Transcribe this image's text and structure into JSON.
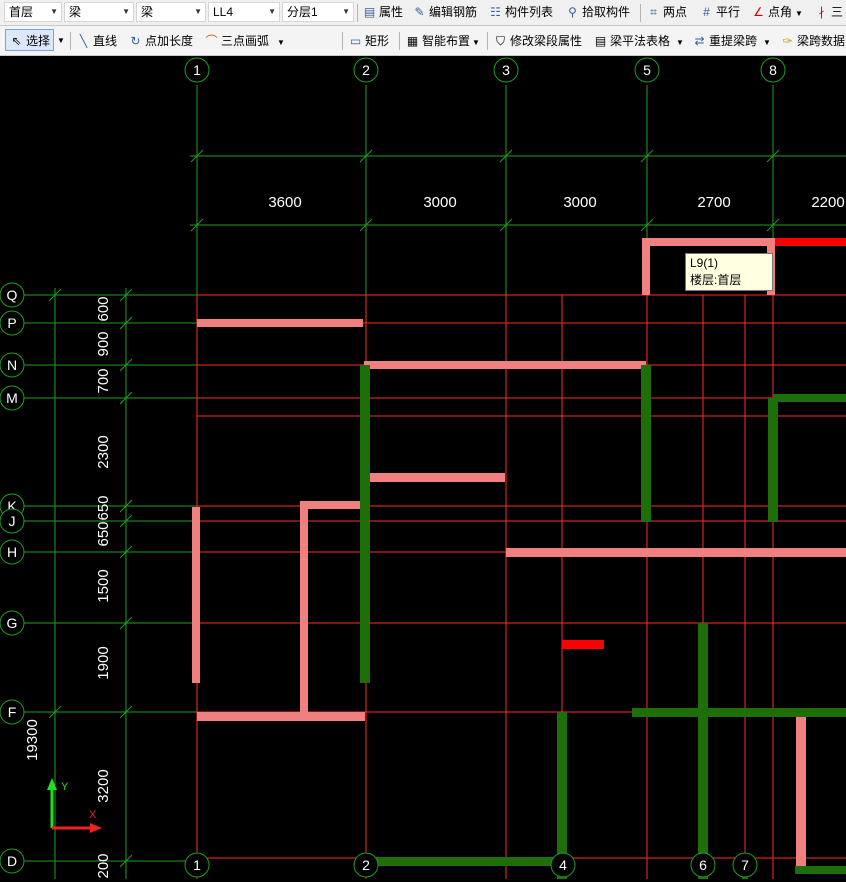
{
  "toolbar1": {
    "floor": "首层",
    "type1": "梁",
    "type2": "梁",
    "component": "LL4",
    "layer": "分层1",
    "properties": "属性",
    "edit_rebar": "编辑钢筋",
    "component_list": "构件列表",
    "pick_component": "拾取构件",
    "two_points": "两点",
    "parallel": "平行",
    "point_angle": "点角",
    "three": "三"
  },
  "toolbar2": {
    "select": "选择",
    "line": "直线",
    "point_length": "点加长度",
    "three_point_arc": "三点画弧",
    "rectangle": "矩形",
    "smart_layout": "智能布置",
    "modify_span_props": "修改梁段属性",
    "beam_table": "梁平法表格",
    "repick_span": "重提梁跨",
    "span_data": "梁跨数据"
  },
  "axes_top": [
    "1",
    "2",
    "3",
    "5",
    "8"
  ],
  "axes_bottom": [
    "1",
    "2",
    "4",
    "6",
    "7"
  ],
  "axes_left": [
    "Q",
    "P",
    "N",
    "M",
    "K",
    "J",
    "H",
    "G",
    "F",
    "D"
  ],
  "dims_top": [
    "3600",
    "3000",
    "3000",
    "2700",
    "2200"
  ],
  "dims_left": [
    "600",
    "900",
    "700",
    "2300",
    "650",
    "650",
    "1500",
    "1900",
    "3200",
    "200"
  ],
  "dim_total_left": "19300",
  "tooltip": {
    "name": "L9(1)",
    "floor": "楼层:首层"
  },
  "ucs": {
    "x": "X",
    "y": "Y"
  },
  "colors": {
    "grid": "#ff2a2a",
    "axis": "#1f9e1f",
    "beam_pink": "#f08080",
    "beam_green": "#1e6e0a",
    "beam_red": "#ff0000",
    "text": "#ffffff"
  }
}
